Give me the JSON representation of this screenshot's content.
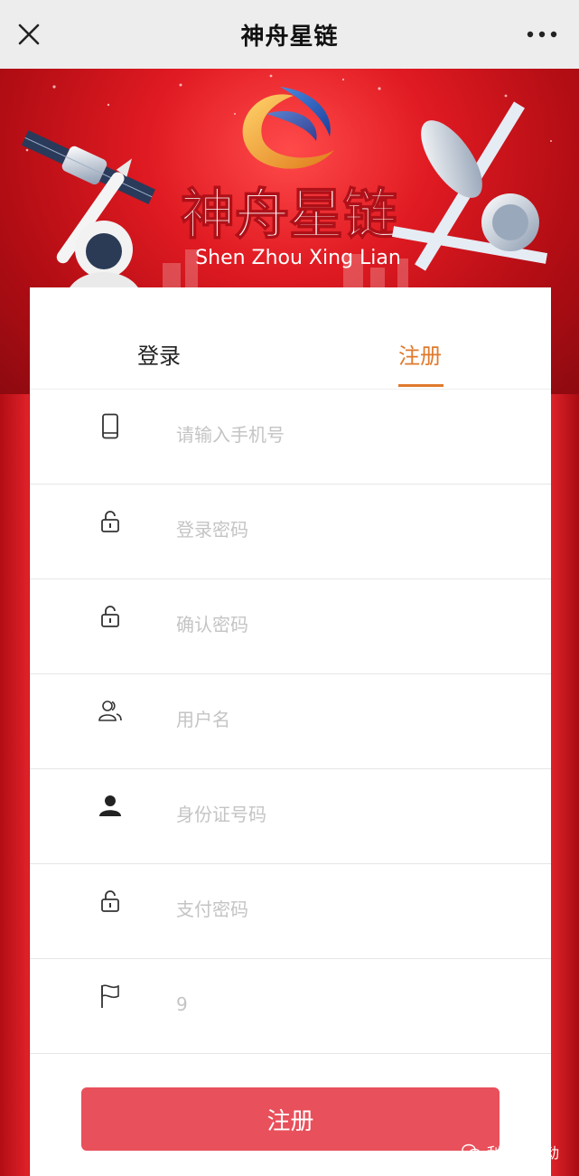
{
  "app": {
    "title": "神舟星链"
  },
  "banner": {
    "logo_text": "神舟星链",
    "logo_subtext": "Shen Zhou Xing Lian"
  },
  "tabs": {
    "login": "登录",
    "register": "注册",
    "active": "register"
  },
  "form": {
    "fields": [
      {
        "icon": "phone-icon",
        "placeholder": "请输入手机号",
        "value": ""
      },
      {
        "icon": "lock-icon",
        "placeholder": "登录密码",
        "value": ""
      },
      {
        "icon": "lock-icon",
        "placeholder": "确认密码",
        "value": ""
      },
      {
        "icon": "users-icon",
        "placeholder": "用户名",
        "value": ""
      },
      {
        "icon": "person-icon",
        "placeholder": "身份证号码",
        "value": ""
      },
      {
        "icon": "lock-icon",
        "placeholder": "支付密码",
        "value": ""
      },
      {
        "icon": "flag-icon",
        "placeholder": "9",
        "value": ""
      }
    ],
    "submit_label": "注册"
  },
  "watermark": {
    "text": "利箭在行动"
  },
  "colors": {
    "accent": "#e07a2c",
    "button": "#e8505b",
    "banner_red": "#d8141c"
  }
}
